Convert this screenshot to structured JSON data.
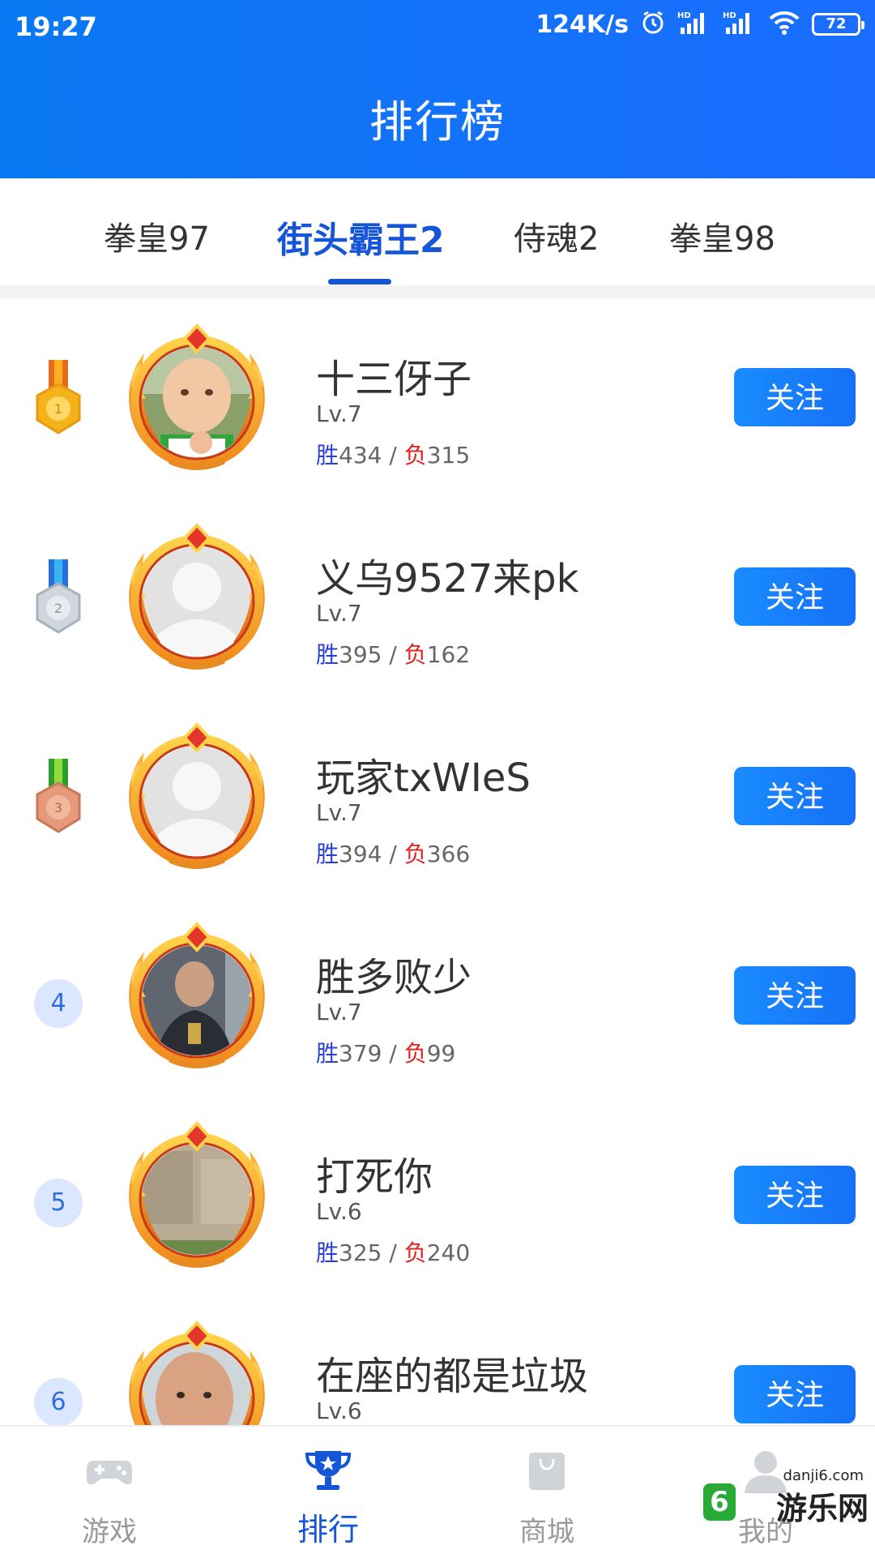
{
  "status_bar": {
    "time": "19:27",
    "net_speed": "124K/s",
    "battery": "72",
    "icons": [
      "alarm-icon",
      "hd-signal-icon",
      "hd-signal-icon",
      "wifi-icon",
      "battery-icon"
    ]
  },
  "header": {
    "title": "排行榜"
  },
  "tabs": [
    {
      "label": "拳皇97",
      "active": false
    },
    {
      "label": "街头霸王2",
      "active": true
    },
    {
      "label": "侍魂2",
      "active": false
    },
    {
      "label": "拳皇98",
      "active": false
    }
  ],
  "labels": {
    "win": "胜",
    "loss": "负",
    "separator": " / "
  },
  "players": [
    {
      "rank": "1",
      "medal": "gold",
      "name": "十三伢子",
      "level": "Lv.7",
      "wins": "434",
      "losses": "315",
      "follow": "关注",
      "avatar": "baby-photo"
    },
    {
      "rank": "2",
      "medal": "silver",
      "name": "义乌9527来pk",
      "level": "Lv.7",
      "wins": "395",
      "losses": "162",
      "follow": "关注",
      "avatar": "default"
    },
    {
      "rank": "3",
      "medal": "bronze",
      "name": "玩家txWIeS",
      "level": "Lv.7",
      "wins": "394",
      "losses": "366",
      "follow": "关注",
      "avatar": "default"
    },
    {
      "rank": "4",
      "medal": "",
      "name": "胜多败少",
      "level": "Lv.7",
      "wins": "379",
      "losses": "99",
      "follow": "关注",
      "avatar": "man-selfie"
    },
    {
      "rank": "5",
      "medal": "",
      "name": "打死你",
      "level": "Lv.6",
      "wins": "325",
      "losses": "240",
      "follow": "关注",
      "avatar": "wall-photo"
    },
    {
      "rank": "6",
      "medal": "",
      "name": "在座的都是垃圾",
      "level": "Lv.6",
      "wins": "",
      "losses": "",
      "follow": "关注",
      "avatar": "man-face"
    }
  ],
  "bottom_nav": [
    {
      "label": "游戏",
      "icon": "gamepad-icon",
      "active": false
    },
    {
      "label": "排行",
      "icon": "trophy-icon",
      "active": true
    },
    {
      "label": "商城",
      "icon": "shopping-bag-icon",
      "active": false
    },
    {
      "label": "我的",
      "icon": "user-icon",
      "active": false
    }
  ],
  "watermark": {
    "text": "游乐网",
    "domain": "danji6.com",
    "logo": "6"
  },
  "colors": {
    "header_bg": "#0a78f2",
    "accent": "#1556d9",
    "win": "#2a3fd6",
    "loss": "#e02020",
    "follow_bg": "#1a8cff"
  }
}
